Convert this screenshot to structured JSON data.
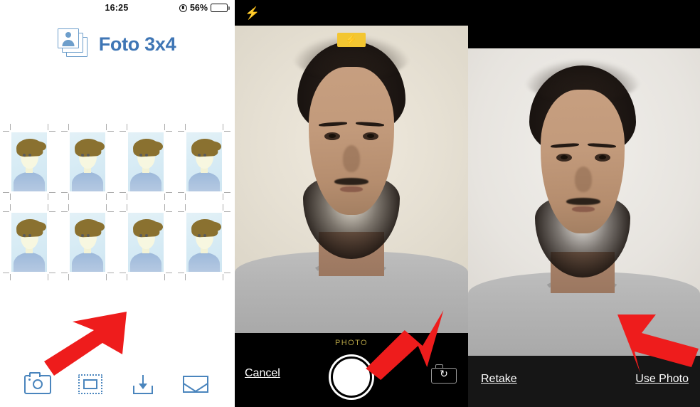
{
  "panels": {
    "app": {
      "status": {
        "time": "16:25",
        "battery_percent": "56%",
        "lock_icon": "orientation-lock-icon"
      },
      "header": {
        "title": "Foto 3x4",
        "icon": "photo-stack-icon"
      },
      "sheet": {
        "rows": 2,
        "columns": 4,
        "cell_count": 8,
        "cell_label": "passport-photo-placeholder"
      },
      "toolbar": [
        {
          "name": "camera",
          "icon": "camera-icon"
        },
        {
          "name": "frame",
          "icon": "frame-icon"
        },
        {
          "name": "save",
          "icon": "download-icon"
        },
        {
          "name": "email",
          "icon": "envelope-icon"
        }
      ]
    },
    "camera": {
      "flash_toggle_icon": "flash-bolt-icon",
      "flash_badge_icon": "flash-bolt-icon",
      "mode_label": "PHOTO",
      "cancel_label": "Cancel",
      "shutter_label": "shutter-button",
      "flip_icon": "camera-flip-icon"
    },
    "preview": {
      "retake_label": "Retake",
      "use_photo_label": "Use Photo"
    }
  },
  "annotations": {
    "arrow_1": "points-to-camera-toolbar-button",
    "arrow_2": "points-to-shutter-button",
    "arrow_3": "points-to-use-photo-button",
    "color": "#ee1c1c"
  }
}
